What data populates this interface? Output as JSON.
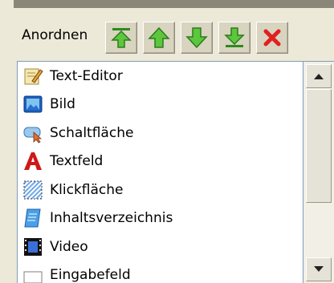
{
  "toolbar": {
    "label": "Anordnen",
    "buttons": [
      {
        "name": "move-to-top",
        "icon": "arrow-up-to-top-icon"
      },
      {
        "name": "move-up",
        "icon": "arrow-up-icon"
      },
      {
        "name": "move-down",
        "icon": "arrow-down-icon"
      },
      {
        "name": "move-to-bottom",
        "icon": "arrow-down-to-bottom-icon"
      },
      {
        "name": "delete",
        "icon": "red-x-icon"
      }
    ]
  },
  "list": {
    "items": [
      {
        "label": "Text-Editor",
        "icon": "pencil-note-icon"
      },
      {
        "label": "Bild",
        "icon": "image-icon"
      },
      {
        "label": "Schaltfläche",
        "icon": "button-icon"
      },
      {
        "label": "Textfeld",
        "icon": "text-a-icon"
      },
      {
        "label": "Klickfläche",
        "icon": "hotspot-icon"
      },
      {
        "label": "Inhaltsverzeichnis",
        "icon": "table-of-contents-icon"
      },
      {
        "label": "Video",
        "icon": "film-icon"
      },
      {
        "label": "Eingabefeld",
        "icon": "input-field-icon"
      }
    ]
  },
  "colors": {
    "arrow_green": "#3fae2a",
    "delete_red": "#e02020",
    "list_border": "#7f9db9"
  }
}
